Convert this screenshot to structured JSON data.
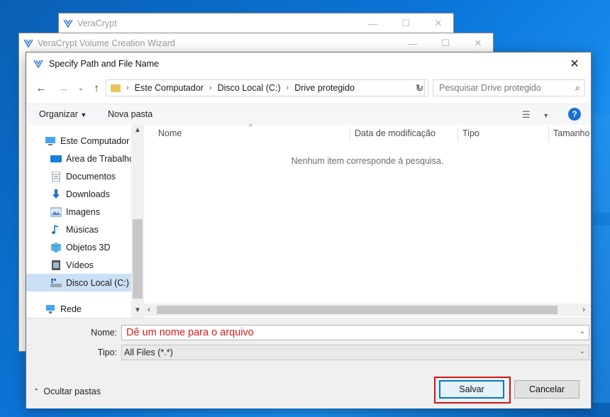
{
  "background_windows": [
    {
      "title": "VeraCrypt"
    },
    {
      "title": "VeraCrypt Volume Creation Wizard"
    }
  ],
  "dialog": {
    "title": "Specify Path and File Name",
    "address": {
      "crumbs": [
        "Este Computador",
        "Disco Local (C:)",
        "Drive protegido"
      ]
    },
    "search_placeholder": "Pesquisar Drive protegido",
    "toolbar": {
      "organize": "Organizar",
      "new_folder": "Nova pasta"
    },
    "tree": [
      {
        "label": "Este Computador",
        "icon": "computer-icon",
        "selected": false
      },
      {
        "label": "Área de Trabalho",
        "icon": "desktop-icon",
        "selected": false
      },
      {
        "label": "Documentos",
        "icon": "documents-icon",
        "selected": false
      },
      {
        "label": "Downloads",
        "icon": "downloads-icon",
        "selected": false
      },
      {
        "label": "Imagens",
        "icon": "pictures-icon",
        "selected": false
      },
      {
        "label": "Músicas",
        "icon": "music-icon",
        "selected": false
      },
      {
        "label": "Objetos 3D",
        "icon": "objects-3d-icon",
        "selected": false
      },
      {
        "label": "Vídeos",
        "icon": "videos-icon",
        "selected": false
      },
      {
        "label": "Disco Local (C:)",
        "icon": "drive-icon",
        "selected": true
      },
      {
        "label": "Rede",
        "icon": "network-icon",
        "selected": false
      }
    ],
    "columns": [
      "Nome",
      "Data de modificação",
      "Tipo",
      "Tamanho"
    ],
    "empty_message": "Nenhum item corresponde à pesquisa.",
    "filename_label": "Nome:",
    "filename_value": "Dê um nome para o arquivo",
    "filetype_label": "Tipo:",
    "filetype_value": "All Files (*.*)",
    "hide_folders": "Ocultar pastas",
    "save_button": "Salvar",
    "cancel_button": "Cancelar",
    "colors": {
      "accent": "#0078d7",
      "highlight_box": "#d0151c",
      "filename_text": "#d81b1b",
      "selection": "#cce0f5"
    }
  }
}
